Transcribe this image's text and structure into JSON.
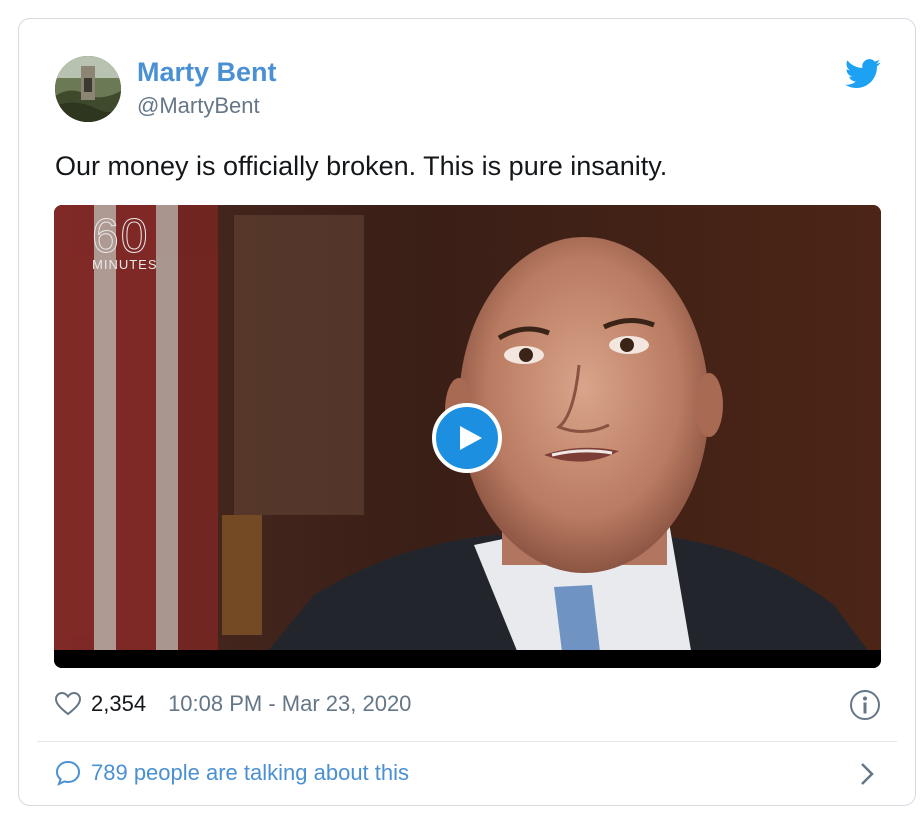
{
  "author": {
    "name": "Marty Bent",
    "handle": "@MartyBent"
  },
  "tweet": {
    "text": "Our money is officially broken. This is pure insanity."
  },
  "media": {
    "logo_number": "60",
    "logo_text": "MINUTES"
  },
  "meta": {
    "likes": "2,354",
    "timestamp": "10:08 PM - Mar 23, 2020"
  },
  "footer": {
    "talking": "789 people are talking about this"
  },
  "colors": {
    "brand_blue": "#1da1f2",
    "link_blue": "#4a90d2",
    "muted_gray": "#657786"
  }
}
